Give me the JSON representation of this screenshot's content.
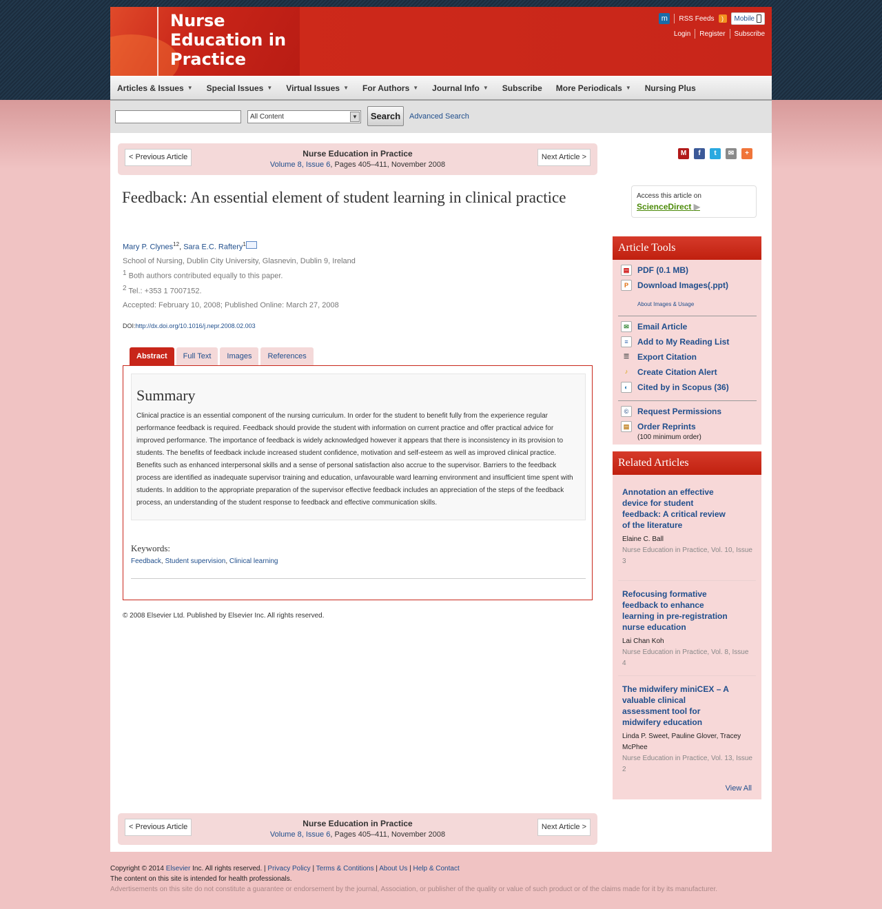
{
  "header": {
    "logo_line1": "Nurse",
    "logo_line2": "Education in",
    "logo_line3": "Practice",
    "rss_label": "RSS Feeds",
    "mobile_label": "Mobile",
    "login": "Login",
    "register": "Register",
    "subscribe": "Subscribe"
  },
  "nav": {
    "items": [
      {
        "label": "Articles & Issues",
        "dropdown": true
      },
      {
        "label": "Special Issues",
        "dropdown": true
      },
      {
        "label": "Virtual Issues",
        "dropdown": true
      },
      {
        "label": "For Authors",
        "dropdown": true
      },
      {
        "label": "Journal Info",
        "dropdown": true
      },
      {
        "label": "Subscribe",
        "dropdown": false
      },
      {
        "label": "More Periodicals",
        "dropdown": true
      },
      {
        "label": "Nursing Plus",
        "dropdown": false
      }
    ]
  },
  "search": {
    "value": "",
    "scope": "All Content",
    "button": "Search",
    "advanced": "Advanced Search"
  },
  "article_nav": {
    "prev": "< Previous Article",
    "next": "Next Article >",
    "journal": "Nurse Education in Practice",
    "volume_link": "Volume 8, Issue 6",
    "pages": ", Pages 405–411, November 2008"
  },
  "article": {
    "title": "Feedback: An essential element of student learning in clinical practice",
    "author1": "Mary P. Clynes",
    "author1_sup": "12",
    "author2": "Sara E.C. Raftery",
    "author2_sup": "1",
    "affiliation": "School of Nursing, Dublin City University, Glasnevin, Dublin 9, Ireland",
    "note1_num": "1",
    "note1": "Both authors contributed equally to this paper.",
    "note2_num": "2",
    "note2": "Tel.: +353 1 7007152.",
    "dates": "Accepted: February 10, 2008; Published Online: March 27, 2008",
    "doi_label": "DOI:",
    "doi": "http://dx.doi.org/10.1016/j.nepr.2008.02.003"
  },
  "tabs": [
    "Abstract",
    "Full Text",
    "Images",
    "References"
  ],
  "abstract": {
    "heading": "Summary",
    "text": "Clinical practice is an essential component of the nursing curriculum. In order for the student to benefit fully from the experience regular performance feedback is required. Feedback should provide the student with information on current practice and offer practical advice for improved performance. The importance of feedback is widely acknowledged however it appears that there is inconsistency in its provision to students. The benefits of feedback include increased student confidence, motivation and self-esteem as well as improved clinical practice. Benefits such as enhanced interpersonal skills and a sense of personal satisfaction also accrue to the supervisor. Barriers to the feedback process are identified as inadequate supervisor training and education, unfavourable ward learning environment and insufficient time spent with students. In addition to the appropriate preparation of the supervisor effective feedback includes an appreciation of the steps of the feedback process, an understanding of the student response to feedback and effective communication skills.",
    "keywords_label": "Keywords:",
    "keywords": [
      "Feedback",
      "Student supervision",
      "Clinical learning"
    ]
  },
  "copyright": "© 2008 Elsevier Ltd. Published by Elsevier Inc. All rights reserved.",
  "sciencedirect": {
    "line1": "Access this article on",
    "line2": "ScienceDirect"
  },
  "tools": {
    "heading": "Article Tools",
    "pdf": "PDF (0.1 MB)",
    "download_images": "Download Images(.ppt)",
    "about_images": "About Images & Usage",
    "email": "Email Article",
    "reading_list": "Add to My Reading List",
    "export": "Export Citation",
    "alert": "Create Citation Alert",
    "cited": "Cited by in Scopus (36)",
    "permissions": "Request Permissions",
    "reprints": "Order Reprints",
    "reprints_note": "(100 minimum order)"
  },
  "related": {
    "heading": "Related Articles",
    "items": [
      {
        "title": "Annotation an effective device for student feedback: A critical review of the literature",
        "authors": "Elaine C. Ball",
        "source": "Nurse Education in Practice, Vol. 10, Issue 3"
      },
      {
        "title": "Refocusing formative feedback to enhance learning in pre-registration nurse education",
        "authors": "Lai Chan Koh",
        "source": "Nurse Education in Practice, Vol. 8, Issue 4"
      },
      {
        "title": "The midwifery miniCEX – A valuable clinical assessment tool for midwifery education",
        "authors": "Linda P. Sweet, Pauline Glover, Tracey McPhee",
        "source": "Nurse Education in Practice, Vol. 13, Issue 2"
      }
    ],
    "view_all": "View All"
  },
  "footer": {
    "copy_prefix": "Copyright © 2014",
    "elsevier": "Elsevier",
    "copy_suffix": "Inc. All rights reserved. |",
    "privacy": "Privacy Policy",
    "terms": "Terms & Contitions",
    "about": "About Us",
    "help": "Help & Contact",
    "line2": "The content on this site is intended for health professionals.",
    "line3": "Advertisements on this site do not constitute a guarantee or endorsement by the journal, Association, or publisher of the quality or value of such product or of the claims made for it by its manufacturer."
  },
  "colors": {
    "brand_red": "#c8261a",
    "link_blue": "#1f4e8c",
    "panel_pink": "#f7d8d8"
  }
}
